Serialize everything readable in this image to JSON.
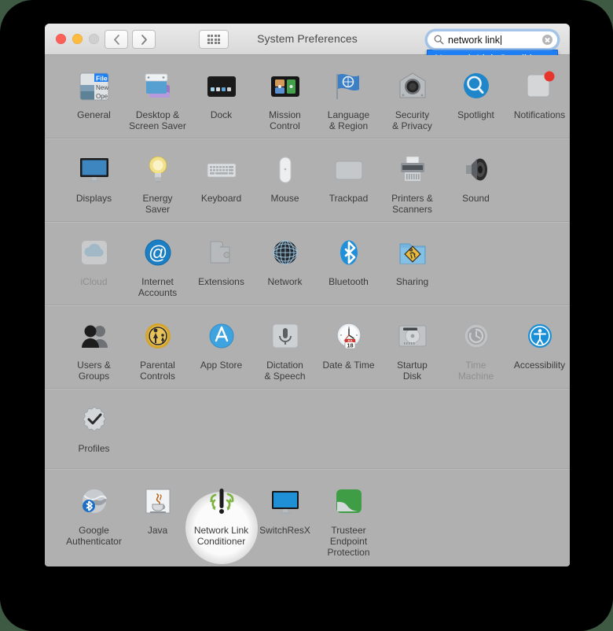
{
  "window": {
    "title": "System Preferences",
    "traffic_lights": [
      "close",
      "minimize",
      "zoom"
    ],
    "back_label": "Back",
    "forward_label": "Forward",
    "showall_label": "Show All"
  },
  "search": {
    "value": "network link",
    "placeholder": "Search",
    "suggestion": "Network Link Conditioner",
    "highlight_color": "#1e7ef4"
  },
  "rows": [
    {
      "items": [
        {
          "label": "General",
          "icon": "general-icon",
          "dim": false
        },
        {
          "label": "Desktop &\nScreen Saver",
          "icon": "desktop-screensaver-icon",
          "dim": false
        },
        {
          "label": "Dock",
          "icon": "dock-icon",
          "dim": false
        },
        {
          "label": "Mission\nControl",
          "icon": "mission-control-icon",
          "dim": false
        },
        {
          "label": "Language\n& Region",
          "icon": "language-region-icon",
          "dim": false
        },
        {
          "label": "Security\n& Privacy",
          "icon": "security-privacy-icon",
          "dim": false
        },
        {
          "label": "Spotlight",
          "icon": "spotlight-icon",
          "dim": false
        },
        {
          "label": "Notifications",
          "icon": "notifications-icon",
          "dim": false
        }
      ]
    },
    {
      "items": [
        {
          "label": "Displays",
          "icon": "displays-icon",
          "dim": false
        },
        {
          "label": "Energy\nSaver",
          "icon": "energy-saver-icon",
          "dim": false
        },
        {
          "label": "Keyboard",
          "icon": "keyboard-icon",
          "dim": false
        },
        {
          "label": "Mouse",
          "icon": "mouse-icon",
          "dim": false
        },
        {
          "label": "Trackpad",
          "icon": "trackpad-icon",
          "dim": false
        },
        {
          "label": "Printers &\nScanners",
          "icon": "printers-scanners-icon",
          "dim": false
        },
        {
          "label": "Sound",
          "icon": "sound-icon",
          "dim": false
        }
      ]
    },
    {
      "items": [
        {
          "label": "iCloud",
          "icon": "icloud-icon",
          "dim": true
        },
        {
          "label": "Internet\nAccounts",
          "icon": "internet-accounts-icon",
          "dim": false
        },
        {
          "label": "Extensions",
          "icon": "extensions-icon",
          "dim": false
        },
        {
          "label": "Network",
          "icon": "network-icon",
          "dim": false
        },
        {
          "label": "Bluetooth",
          "icon": "bluetooth-icon",
          "dim": false
        },
        {
          "label": "Sharing",
          "icon": "sharing-icon",
          "dim": false
        }
      ]
    },
    {
      "items": [
        {
          "label": "Users &\nGroups",
          "icon": "users-groups-icon",
          "dim": false
        },
        {
          "label": "Parental\nControls",
          "icon": "parental-controls-icon",
          "dim": false
        },
        {
          "label": "App Store",
          "icon": "app-store-icon",
          "dim": false
        },
        {
          "label": "Dictation\n& Speech",
          "icon": "dictation-speech-icon",
          "dim": false
        },
        {
          "label": "Date & Time",
          "icon": "date-time-icon",
          "dim": false
        },
        {
          "label": "Startup\nDisk",
          "icon": "startup-disk-icon",
          "dim": false
        },
        {
          "label": "Time\nMachine",
          "icon": "time-machine-icon",
          "dim": true
        },
        {
          "label": "Accessibility",
          "icon": "accessibility-icon",
          "dim": false
        }
      ]
    },
    {
      "items": [
        {
          "label": "Profiles",
          "icon": "profiles-icon",
          "dim": false
        }
      ]
    }
  ],
  "third_party": {
    "items": [
      {
        "label": "Google\nAuthenticator",
        "icon": "google-authenticator-icon",
        "dim": false,
        "highlight": false
      },
      {
        "label": "Java",
        "icon": "java-icon",
        "dim": false,
        "highlight": false
      },
      {
        "label": "Network Link\nConditioner",
        "icon": "network-link-conditioner-icon",
        "dim": false,
        "highlight": true
      },
      {
        "label": "SwitchResX",
        "icon": "switchresx-icon",
        "dim": false,
        "highlight": false
      },
      {
        "label": "Trusteer\nEndpoint Protection",
        "icon": "trusteer-endpoint-protection-icon",
        "dim": false,
        "highlight": false
      }
    ]
  }
}
